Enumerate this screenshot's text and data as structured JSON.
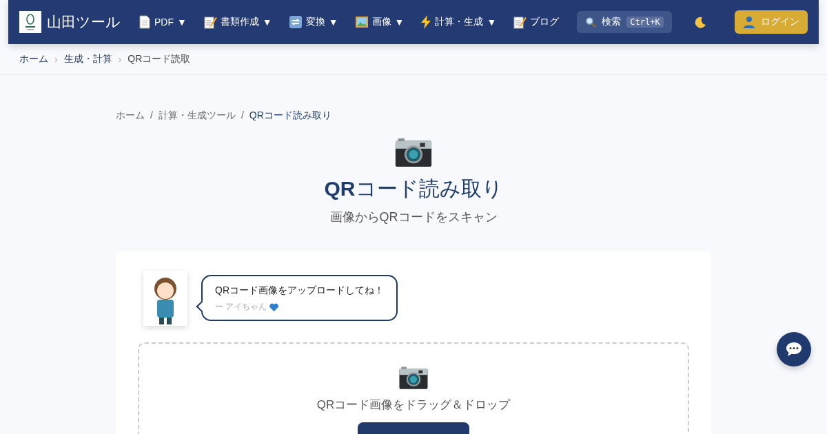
{
  "header": {
    "brand": "山田ツール",
    "nav": [
      {
        "kind": "document",
        "label": "PDF",
        "caret": "▼"
      },
      {
        "kind": "memo",
        "label": "書類作成",
        "caret": "▼"
      },
      {
        "kind": "convert",
        "label": "変換",
        "caret": "▼"
      },
      {
        "kind": "picture",
        "label": "画像",
        "caret": "▼"
      },
      {
        "kind": "bolt",
        "label": "計算・生成",
        "caret": "▼"
      },
      {
        "kind": "memo",
        "label": "ブログ"
      }
    ],
    "search": {
      "label": "検索",
      "shortcut": "Ctrl+K"
    },
    "login": "ログイン"
  },
  "top_breadcrumb": [
    "ホーム",
    "生成・計算",
    "QRコード読取"
  ],
  "top_breadcrumb_separator": "›",
  "breadcrumb": [
    "ホーム",
    "計算・生成ツール",
    "QRコード読み取り"
  ],
  "breadcrumb_separator": "/",
  "page": {
    "title": "**QR**コード読み取り",
    "subtitle": "画像からQRコードをスキャン"
  },
  "speech": {
    "message": "QRコード画像をアップロードしてね！",
    "signature": "ー アイちゃん"
  },
  "dropzone": {
    "text": "QRコード画像をドラッグ＆ドロップ"
  }
}
